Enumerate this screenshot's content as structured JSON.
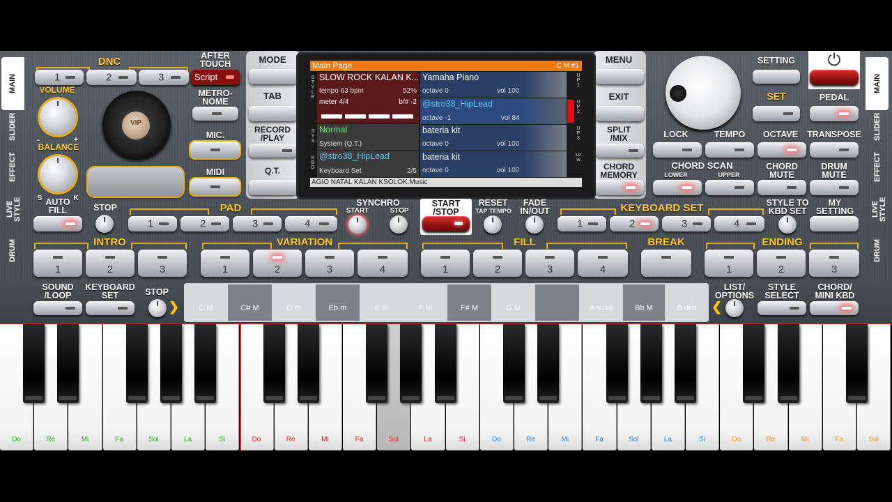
{
  "side_tabs_left": [
    "MAIN",
    "SLIDER",
    "EFFECT",
    "LIVE\nSTYLE",
    "DRUM"
  ],
  "side_tabs_right": [
    "MAIN",
    "SLIDER",
    "EFFECT",
    "LIVE\nSTYLE",
    "DRUM"
  ],
  "dnc": {
    "label": "DNC",
    "buttons": [
      "1",
      "2",
      "3"
    ],
    "script": "Script"
  },
  "after_touch": "AFTER\nTOUCH",
  "metronome": "METRO-\nNOME",
  "mic": "MIC.",
  "midi": "MIDI",
  "volume": "VOLUME",
  "balance": "BALANCE",
  "balance_s": "S",
  "balance_k": "K",
  "minus": "-",
  "plus": "+",
  "vip_logo": "VIP",
  "left_col": {
    "mode": "MODE",
    "tab": "TAB",
    "record": "RECORD\n/PLAY",
    "qt": "Q.T."
  },
  "right_col": {
    "menu": "MENU",
    "exit": "EXIT",
    "split": "SPLIT\n/MIX",
    "chord_memory": "CHORD\nMEMORY"
  },
  "screen": {
    "header": "Main Page",
    "header_right": "C M #1",
    "style_side": "STYLE",
    "sys_side": "SYS",
    "kbd_side": "KBD",
    "up1_side": "UP1",
    "up2_side": "UP2",
    "up3_side": "UP3",
    "low_side": "Low",
    "style_name": "SLOW ROCK KALAN K...",
    "tempo": "tempo 63 bpm",
    "percent": "52%",
    "meter": "meter 4/4",
    "transpose": "b/# -2",
    "system_name": "Normal",
    "system_sub": "System (Q.T.)",
    "kbd_name": "@stro38_HipLead",
    "kbd_sub": "Keyboard Set",
    "kbd_page": "2/5",
    "footer": "AGIO NATAL KALAN KSOLOK.Music",
    "parts": [
      {
        "name": "Yamaha Piano",
        "octave": "octave  0",
        "vol": "vol 100"
      },
      {
        "name": "@stro38_HipLead",
        "octave": "octave -1",
        "vol": "vol 84"
      },
      {
        "name": "bateria kit",
        "octave": "octave  0",
        "vol": "vol 100"
      },
      {
        "name": "bateria kit",
        "octave": "octave  0",
        "vol": "vol 100"
      }
    ]
  },
  "top_right": {
    "setting": "SETTING",
    "set": "SET",
    "pedal": "PEDAL",
    "lock": "LOCK",
    "tempo": "TEMPO",
    "octave": "OCTAVE",
    "transpose": "TRANSPOSE",
    "chord_scan": "CHORD SCAN",
    "lower": "LOWER",
    "upper": "UPPER",
    "chord_mute": "CHORD\nMUTE",
    "drum_mute": "DRUM\nMUTE",
    "power_icon": "⏻"
  },
  "row2": {
    "auto_fill": "AUTO\nFILL",
    "stop": "STOP",
    "pad": "PAD",
    "pad_buttons": [
      "1",
      "2",
      "3",
      "4"
    ],
    "synchro": "SYNCHRO",
    "synchro_start": "START",
    "synchro_stop": "STOP",
    "start_stop": "START\n/STOP",
    "reset": "RESET",
    "tap_tempo": "TAP TEMPO",
    "fade": "FADE\nIN/OUT",
    "keyboard_set": "KEYBOARD SET",
    "kbd_buttons": [
      "1",
      "2",
      "3",
      "4"
    ],
    "style_to_kbd": "STYLE TO\nKBD SET",
    "my_setting": "MY\nSETTING"
  },
  "row3": {
    "intro": "INTRO",
    "intro_buttons": [
      "1",
      "2",
      "3"
    ],
    "variation": "VARIATION",
    "variation_buttons": [
      "1",
      "2",
      "3",
      "4"
    ],
    "fill": "FILL",
    "fill_buttons": [
      "1",
      "2",
      "3",
      "4"
    ],
    "break": "BREAK",
    "ending": "ENDING",
    "ending_buttons": [
      "1",
      "2",
      "3"
    ]
  },
  "row4": {
    "sound_loop": "SOUND\n/LOOP",
    "keyboard_set": "KEYBOARD\nSET",
    "stop": "STOP",
    "list_options": "LIST/\nOPTIONS",
    "style_select": "STYLE\nSELECT",
    "chord_mini": "CHORD/\nMINI KBD"
  },
  "chords": [
    "C M",
    "C# M",
    "D m",
    "Eb m",
    "E m",
    "F M",
    "F# M",
    "G M",
    "",
    "A sus4",
    "Bb M",
    "B dim"
  ],
  "white_keys": [
    "Do",
    "Re",
    "Mi",
    "Fa",
    "Sol",
    "La",
    "Si",
    "Do",
    "Re",
    "Mi",
    "Fa",
    "Sol",
    "La",
    "Si",
    "Do",
    "Re",
    "Mi",
    "Fa",
    "Sol",
    "La",
    "Si",
    "Do",
    "Re",
    "Mi",
    "Fa",
    "Sol"
  ],
  "colors": {
    "accent": "#ffcc33",
    "orange": "#f07a10",
    "red": "#cc2222",
    "key_label_green": "#22aa22",
    "key_label_red": "#e02020",
    "key_label_blue": "#2a7fd0",
    "key_label_orange": "#f09020"
  }
}
